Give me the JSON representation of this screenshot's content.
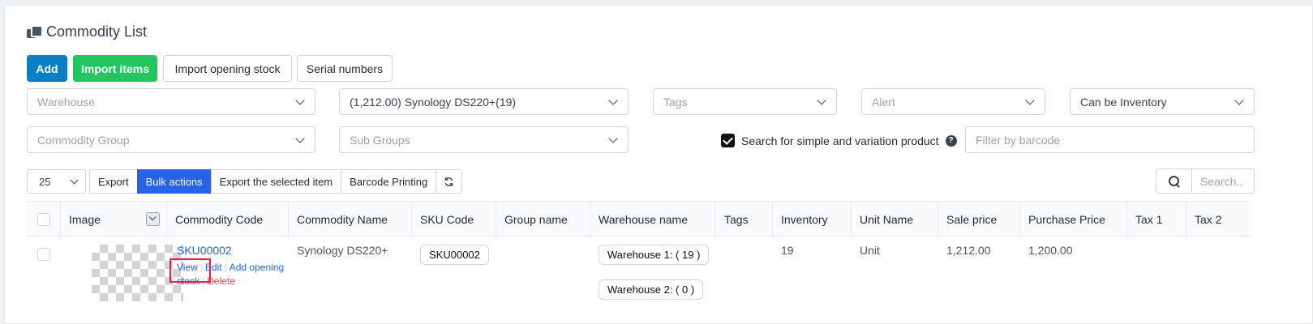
{
  "page": {
    "title": "Commodity List"
  },
  "actions": {
    "add": "Add",
    "import_items": "Import items",
    "import_opening_stock": "Import opening stock",
    "serial_numbers": "Serial numbers"
  },
  "filters": {
    "warehouse": "Warehouse",
    "commodity": "(1,212.00) Synology DS220+(19)",
    "tags": "Tags",
    "alert": "Alert",
    "inventory_type": "Can be Inventory",
    "commodity_group": "Commodity Group",
    "sub_groups": "Sub Groups",
    "search_variation_label": "Search for simple and variation product",
    "search_variation_checked": true,
    "barcode_placeholder": "Filter by barcode"
  },
  "toolbar": {
    "page_size": "25",
    "export": "Export",
    "bulk_actions": "Bulk actions",
    "export_selected": "Export the selected item",
    "barcode_printing": "Barcode Printing",
    "search_placeholder": "Search.."
  },
  "table": {
    "columns": [
      "Image",
      "Commodity Code",
      "Commodity Name",
      "SKU Code",
      "Group name",
      "Warehouse name",
      "Tags",
      "Inventory",
      "Unit Name",
      "Sale price",
      "Purchase Price",
      "Tax 1",
      "Tax 2"
    ],
    "rows": [
      {
        "commodity_code": "SKU00002",
        "actions": {
          "view": "View",
          "edit": "Edit",
          "add": "Add",
          "opening_stock": "opening stock",
          "delete": "Delete"
        },
        "commodity_name": "Synology DS220+",
        "sku_code": "SKU00002",
        "warehouses": [
          "Warehouse 1: ( 19 )",
          "Warehouse 2: ( 0 )"
        ],
        "inventory": "19",
        "unit_name": "Unit",
        "sale_price": "1,212.00",
        "purchase_price": "1,200.00"
      }
    ]
  }
}
